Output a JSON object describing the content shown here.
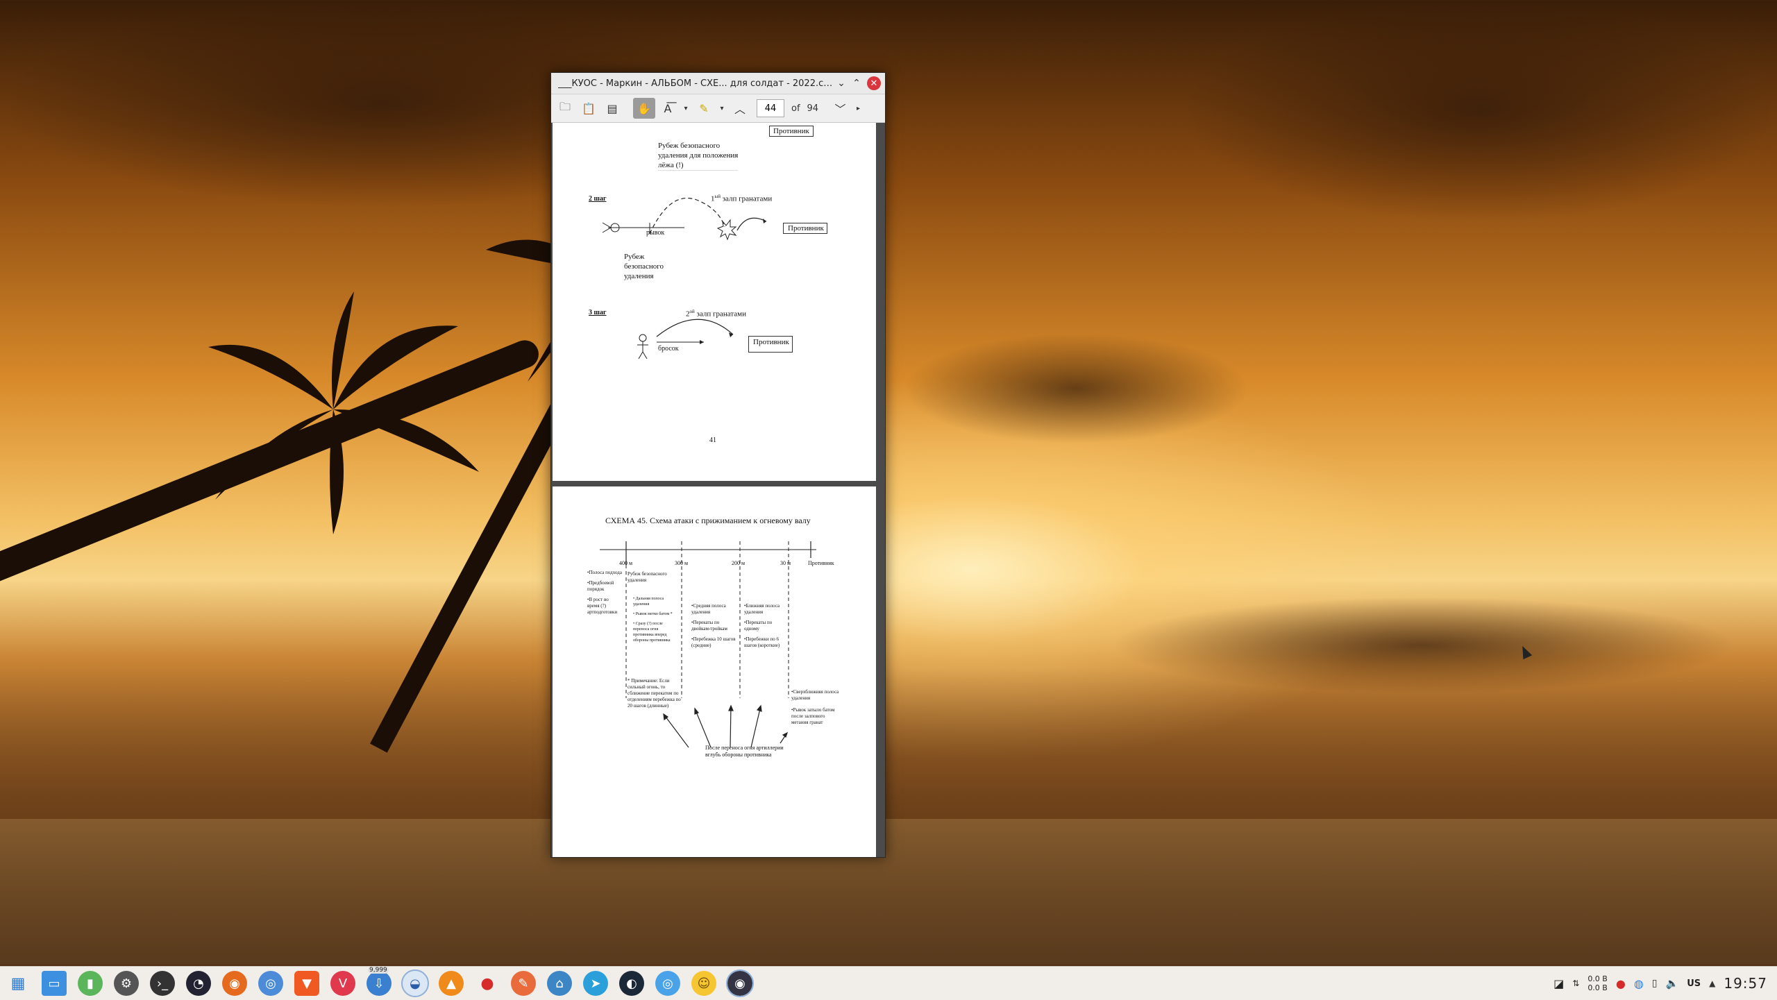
{
  "window": {
    "title": "___КУОС - Маркин - АЛЬБОМ - СХЕ... для солдат - 2022.cdr — Okular",
    "minimize_icon": "chevron-down-icon",
    "maximize_icon": "chevron-up-icon",
    "close_icon": "close-icon"
  },
  "toolbar": {
    "page_current": "44",
    "of_label": "of",
    "page_total": "94"
  },
  "page1": {
    "label_protivnik_top": "Противник",
    "rubezh_text_1": "Рубеж безопасного",
    "rubezh_text_2": "удаления для положения",
    "rubezh_text_3": "лёжа (!)",
    "step2_label": "2 шаг",
    "step2_salvo": "1",
    "step2_salvo_sup": "ый",
    "step2_salvo_rest": " залп гранатами",
    "step2_ryvok": "рывок",
    "step2_protivnik": "Противник",
    "step2_rubezh_1": "Рубеж",
    "step2_rubezh_2": "безопасного",
    "step2_rubezh_3": "удаления",
    "step3_label": "3 шаг",
    "step3_salvo": "2",
    "step3_salvo_sup": "ой",
    "step3_salvo_rest": " залп гранатами",
    "step3_brosok": "бросок",
    "step3_protivnik": "Противник",
    "page_number": "41"
  },
  "page2": {
    "title": "СХЕМА 45. Схема атаки с прижиманием к огневому валу",
    "dist_400": "400 м",
    "dist_300": "300 м",
    "dist_200": "200 м",
    "dist_30": "30 м",
    "protivnik": "Противник",
    "col1": [
      "•Полоса подхода",
      "•Предбоевой порядок",
      "•В рост во время (?) артподготовки"
    ],
    "col2_head": "Рубеж безопасного удаления",
    "col2": [
      "• Дальняя полоса удаления",
      "• Рывок метко батом *",
      "• Сразу (?) после переноса огня противника вперед обороны противника"
    ],
    "col2_note": "* Примечание: Если сильный огонь, то сближение перекатом по отделениям перебежка по 20 шагов (длинные)",
    "col3": [
      "•Средняя полоса удаления",
      "•Перекаты по двойкам-тройкам",
      "•Перебежка 10 шагов (средние)"
    ],
    "col4": [
      "•Ближняя полоса удаления",
      "•Перекаты по одному",
      "•Перебежки по 6 шагов (короткие)"
    ],
    "col5": [
      "•Сверхближняя полоса удаления",
      "•Рывок затыло батом после залпового метания гранат"
    ],
    "bottom_note": "После переноса огня артиллерии вглубь обороны противника"
  },
  "taskbar": {
    "icons": [
      "app-launcher-icon",
      "file-manager-icon",
      "system-monitor-icon",
      "settings-icon",
      "terminal-icon",
      "audio-icon",
      "firefox-icon",
      "chromium-icon",
      "brave-icon",
      "vivaldi-icon",
      "updates-icon",
      "okular-icon",
      "vlc-icon",
      "strawberry-icon",
      "text-editor-icon",
      "network-icon",
      "telegram-icon",
      "steam-icon",
      "browser-icon",
      "emoji-icon",
      "screenshot-icon"
    ],
    "badge": "9,999",
    "net_down": "0.0 B",
    "net_up": "0.0 B",
    "keyboard_layout": "US",
    "clock": "19:57"
  }
}
